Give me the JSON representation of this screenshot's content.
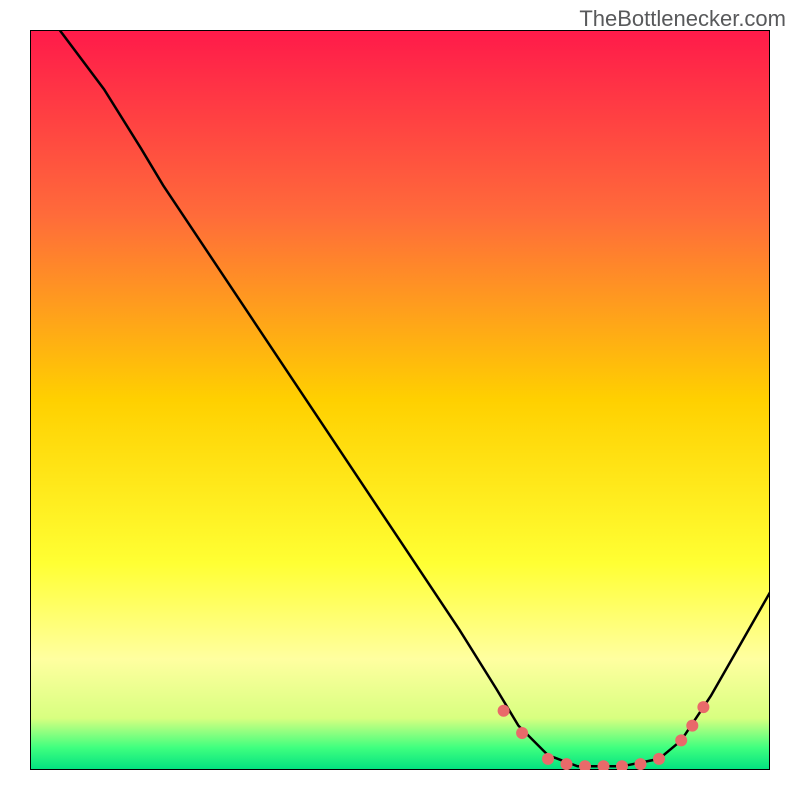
{
  "watermark": "TheBottlenecker.com",
  "chart_data": {
    "type": "line",
    "title": "",
    "xlabel": "",
    "ylabel": "",
    "xlim": [
      0,
      100
    ],
    "ylim": [
      0,
      100
    ],
    "background": {
      "type": "vertical-gradient",
      "stops": [
        {
          "offset": 0,
          "color": "#ff1a4a"
        },
        {
          "offset": 25,
          "color": "#ff6b3a"
        },
        {
          "offset": 50,
          "color": "#ffd000"
        },
        {
          "offset": 72,
          "color": "#ffff33"
        },
        {
          "offset": 85,
          "color": "#ffffa0"
        },
        {
          "offset": 93,
          "color": "#d8ff80"
        },
        {
          "offset": 97,
          "color": "#3fff7f"
        },
        {
          "offset": 100,
          "color": "#00e080"
        }
      ]
    },
    "series": [
      {
        "name": "bottleneck-curve",
        "color": "#000000",
        "points": [
          {
            "x": 4,
            "y": 100
          },
          {
            "x": 10,
            "y": 92
          },
          {
            "x": 15,
            "y": 84
          },
          {
            "x": 18,
            "y": 79
          },
          {
            "x": 22,
            "y": 73
          },
          {
            "x": 30,
            "y": 61
          },
          {
            "x": 40,
            "y": 46
          },
          {
            "x": 50,
            "y": 31
          },
          {
            "x": 58,
            "y": 19
          },
          {
            "x": 63,
            "y": 11
          },
          {
            "x": 66,
            "y": 6
          },
          {
            "x": 70,
            "y": 2
          },
          {
            "x": 74,
            "y": 0.5
          },
          {
            "x": 80,
            "y": 0.5
          },
          {
            "x": 85,
            "y": 1.5
          },
          {
            "x": 88,
            "y": 4
          },
          {
            "x": 92,
            "y": 10
          },
          {
            "x": 96,
            "y": 17
          },
          {
            "x": 100,
            "y": 24
          }
        ]
      }
    ],
    "markers": [
      {
        "x": 64,
        "y": 8,
        "color": "#e96a6a",
        "r": 6
      },
      {
        "x": 66.5,
        "y": 5,
        "color": "#e96a6a",
        "r": 6
      },
      {
        "x": 70,
        "y": 1.5,
        "color": "#e96a6a",
        "r": 6
      },
      {
        "x": 72.5,
        "y": 0.8,
        "color": "#e96a6a",
        "r": 6
      },
      {
        "x": 75,
        "y": 0.5,
        "color": "#e96a6a",
        "r": 6
      },
      {
        "x": 77.5,
        "y": 0.5,
        "color": "#e96a6a",
        "r": 6
      },
      {
        "x": 80,
        "y": 0.5,
        "color": "#e96a6a",
        "r": 6
      },
      {
        "x": 82.5,
        "y": 0.8,
        "color": "#e96a6a",
        "r": 6
      },
      {
        "x": 85,
        "y": 1.5,
        "color": "#e96a6a",
        "r": 6
      },
      {
        "x": 88,
        "y": 4,
        "color": "#e96a6a",
        "r": 6
      },
      {
        "x": 89.5,
        "y": 6,
        "color": "#e96a6a",
        "r": 6
      },
      {
        "x": 91,
        "y": 8.5,
        "color": "#e96a6a",
        "r": 6
      }
    ]
  }
}
